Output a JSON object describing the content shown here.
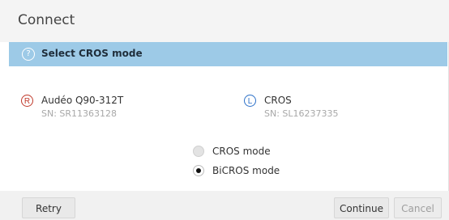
{
  "dialog": {
    "title": "Connect"
  },
  "banner": {
    "icon": "question-circle-icon",
    "icon_glyph": "?",
    "text": "Select CROS mode",
    "color": "#9dcae7"
  },
  "devices": {
    "right": {
      "side_letter": "R",
      "side_color": "#c0392b",
      "name": "Audéo Q90-312T",
      "serial": "SN: SR11363128"
    },
    "left": {
      "side_letter": "L",
      "side_color": "#2d71c8",
      "name": "CROS",
      "serial": "SN: SL16237335"
    }
  },
  "mode_options": {
    "cros_label": "CROS mode",
    "bicros_label": "BiCROS mode",
    "selected": "BiCROS mode"
  },
  "footer": {
    "retry_label": "Retry",
    "continue_label": "Continue",
    "cancel_label": "Cancel"
  }
}
